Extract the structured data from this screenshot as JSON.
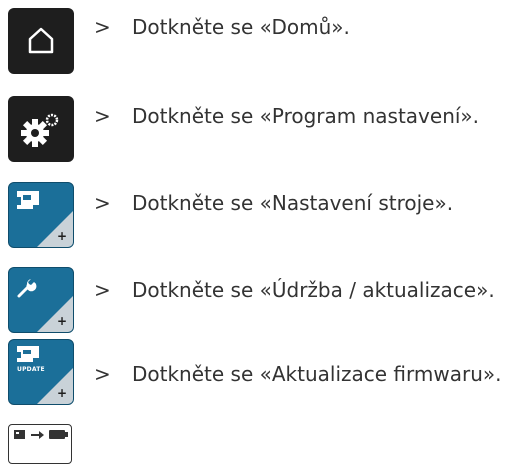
{
  "steps": [
    {
      "arrow": ">",
      "text": "Dotkněte se «Domů».",
      "icon": "home-icon"
    },
    {
      "arrow": ">",
      "text": "Dotkněte se «Program nastavení».",
      "icon": "settings-gears-icon"
    },
    {
      "arrow": ">",
      "text": "Dotkněte se «Nastavení stroje».",
      "icon": "machine-settings-icon"
    },
    {
      "arrow": ">",
      "text": "Dotkněte se «Údržba / aktualizace».",
      "icon": "wrench-icon"
    },
    {
      "arrow": ">",
      "text": "Dotkněte se «Aktualizace firmwaru».",
      "icon": "firmware-update-icon",
      "icon_label": "UPDATE"
    }
  ],
  "last_icon": "usb-transfer-icon",
  "colors": {
    "dark_button": "#1e1e1e",
    "blue_button": "#1b6f99",
    "text": "#333333"
  }
}
